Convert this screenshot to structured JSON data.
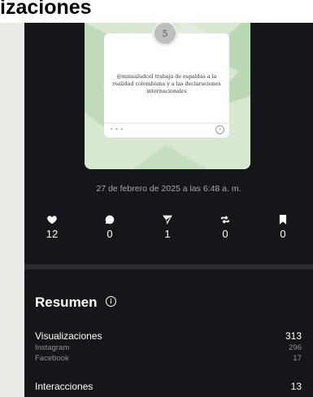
{
  "page": {
    "heading": "izaciones"
  },
  "post": {
    "number": "5",
    "text": "@minsaludcol trabaja de espaldas a la realidad colombiana y a las declaraciones internacionales",
    "dots": "• • •",
    "plus": "+"
  },
  "date": "27 de febrero de 2025 a las 6:48 a. m.",
  "metrics": [
    {
      "icon": "heart-icon",
      "value": "12"
    },
    {
      "icon": "comment-icon",
      "value": "0"
    },
    {
      "icon": "share-icon",
      "value": "1"
    },
    {
      "icon": "repost-icon",
      "value": "0"
    },
    {
      "icon": "bookmark-icon",
      "value": "0"
    }
  ],
  "summary": {
    "title": "Resumen",
    "info_icon": "info-icon",
    "visualizaciones": {
      "label": "Visualizaciones",
      "value": "313"
    },
    "instagram": {
      "label": "Instagram",
      "value": "296"
    },
    "facebook": {
      "label": "Facebook",
      "value": "17"
    },
    "interacciones": {
      "label": "Interacciones",
      "value": "13"
    }
  },
  "colors": {
    "panel_bg": "#141619",
    "card_bg": "#cfe2c8",
    "text_primary": "#ffffff",
    "text_secondary": "#8d9196"
  }
}
